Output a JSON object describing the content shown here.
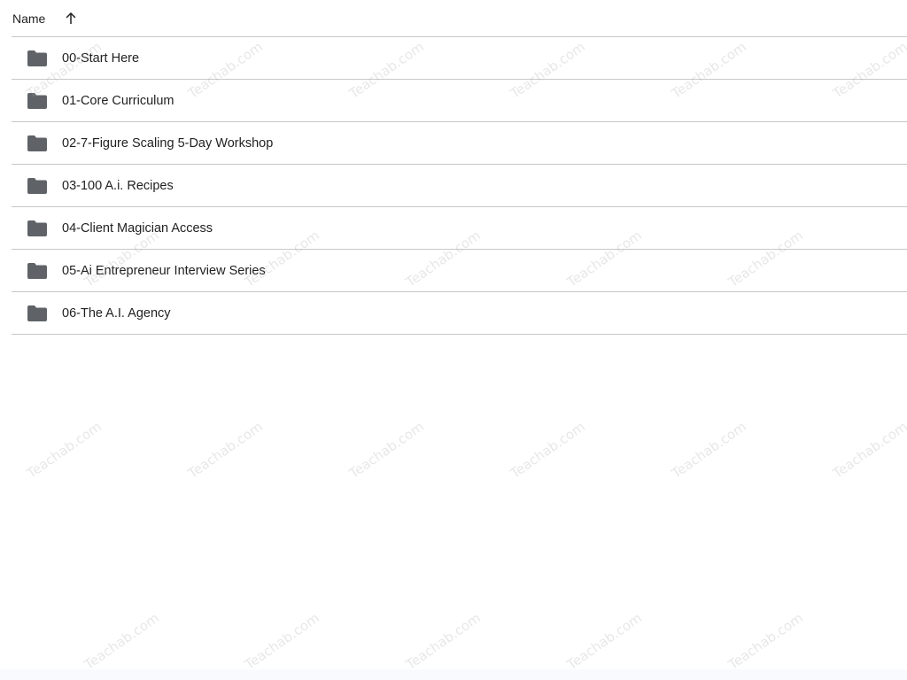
{
  "header": {
    "name_label": "Name",
    "sort_icon": "arrow-upward-icon"
  },
  "folders": [
    {
      "name": "00-Start Here",
      "icon": "folder-icon"
    },
    {
      "name": "01-Core Curriculum",
      "icon": "folder-icon"
    },
    {
      "name": "02-7-Figure Scaling 5-Day Workshop",
      "icon": "folder-icon"
    },
    {
      "name": "03-100 A.i. Recipes",
      "icon": "folder-icon"
    },
    {
      "name": "04-Client Magician Access",
      "icon": "folder-icon"
    },
    {
      "name": "05-Ai Entrepreneur Interview Series",
      "icon": "folder-icon"
    },
    {
      "name": "06-The A.I. Agency",
      "icon": "folder-icon"
    }
  ],
  "watermark": {
    "text": "Teachab.com"
  },
  "colors": {
    "folder": "#5f6368",
    "divider": "#c7c7c7",
    "text": "#1f1f1f"
  }
}
